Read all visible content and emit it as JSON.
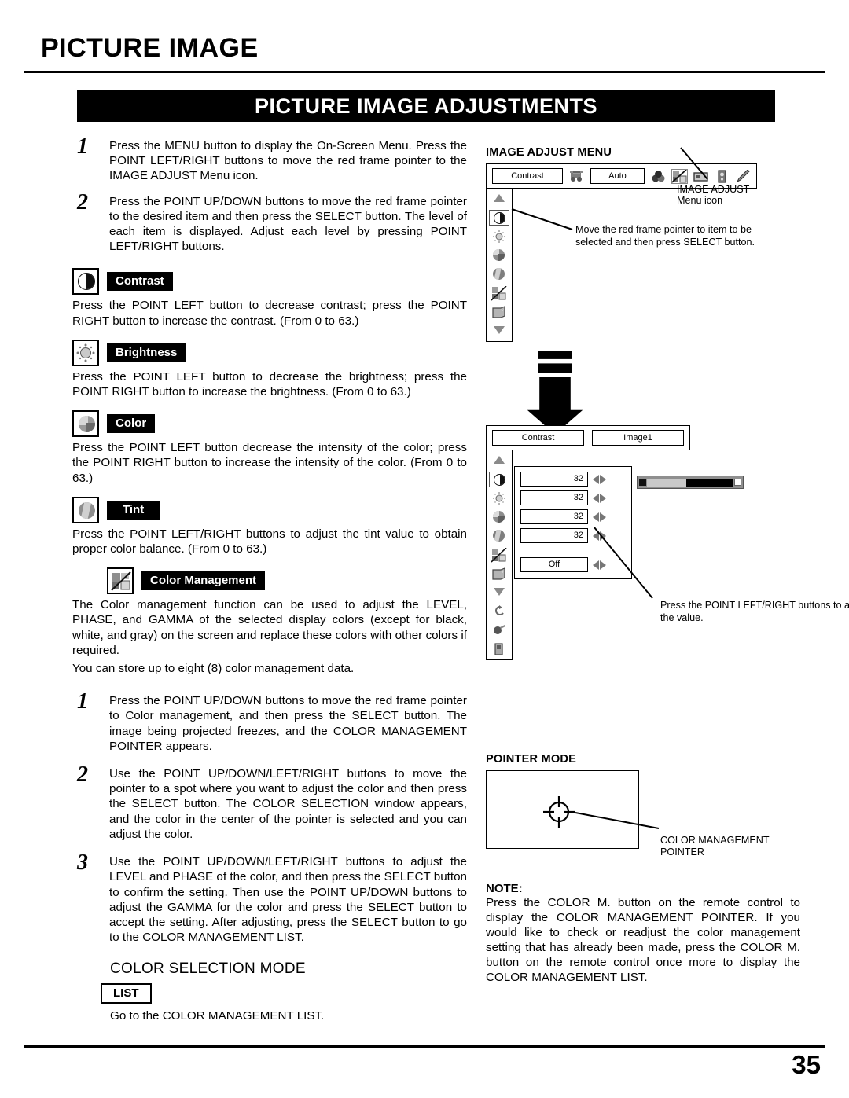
{
  "header": {
    "page_title": "PICTURE IMAGE",
    "banner": "PICTURE IMAGE ADJUSTMENTS",
    "page_number": "35"
  },
  "left": {
    "intro_steps": [
      {
        "num": "1",
        "text": "Press the MENU button to display the On-Screen Menu. Press the POINT LEFT/RIGHT buttons to move the red frame pointer to the IMAGE ADJUST Menu icon."
      },
      {
        "num": "2",
        "text": "Press the POINT UP/DOWN buttons to move the red frame pointer to the desired item and then press the SELECT button. The level of each item is displayed. Adjust each level by pressing POINT LEFT/RIGHT buttons."
      }
    ],
    "features": [
      {
        "icon": "contrast-icon",
        "label": "Contrast",
        "text": "Press the POINT LEFT button to decrease contrast; press the POINT RIGHT button to increase the contrast. (From 0 to 63.)"
      },
      {
        "icon": "brightness-icon",
        "label": "Brightness",
        "text": "Press the POINT LEFT button to decrease the brightness; press the POINT RIGHT button to increase the brightness. (From 0 to 63.)"
      },
      {
        "icon": "color-icon",
        "label": "Color",
        "text": "Press the POINT LEFT button decrease the intensity of the color; press the POINT RIGHT button to increase the intensity of the color.  (From 0 to 63.)"
      },
      {
        "icon": "tint-icon",
        "label": "Tint",
        "text": "Press the POINT LEFT/RIGHT buttons to adjust the tint value to obtain proper color balance. (From 0 to 63.)"
      },
      {
        "icon": "color-management-icon",
        "label": "Color Management",
        "text": "The Color management function can be used to adjust the LEVEL, PHASE, and GAMMA of the selected display colors (except for black, white, and gray) on the screen and replace these colors with other colors if required.",
        "text2": "You can store up to eight (8) color management data."
      }
    ],
    "cm_steps": [
      {
        "num": "1",
        "text": "Press the POINT UP/DOWN buttons to move the red frame pointer to Color management, and then press the SELECT button. The image being projected freezes, and the COLOR MANAGEMENT POINTER appears."
      },
      {
        "num": "2",
        "text": "Use the POINT UP/DOWN/LEFT/RIGHT buttons to move the pointer to a spot where you want to adjust the color and then press the SELECT button. The COLOR SELECTION window appears, and the color in the center of the pointer is selected and you can adjust the color."
      },
      {
        "num": "3",
        "text": "Use the POINT UP/DOWN/LEFT/RIGHT buttons to adjust the LEVEL and PHASE of the color, and then press the SELECT button to confirm the setting. Then use the POINT UP/DOWN buttons to adjust the GAMMA for the color and press the SELECT button to accept the setting. After adjusting, press the SELECT button to go to the COLOR MANAGEMENT LIST."
      }
    ],
    "color_selection_mode": {
      "title": "COLOR SELECTION MODE",
      "chip": "LIST",
      "desc": "Go to the COLOR MANAGEMENT LIST."
    }
  },
  "right": {
    "image_adjust_menu": {
      "heading": "IMAGE ADJUST MENU",
      "top_bar": {
        "field1": "Contrast",
        "field2": "Auto",
        "icons": [
          "gear-cart-icon",
          "color-balls-icon",
          "image-adjust-icon",
          "screen-icon",
          "sound-icon",
          "pointer-wand-icon"
        ]
      },
      "callout_menu_icon": "IMAGE ADJUST Menu icon",
      "callout_move_pointer": "Move the red frame pointer to item to be selected and then press SELECT button.",
      "rail_icons": [
        "up-arrow-icon",
        "contrast-icon",
        "brightness-icon",
        "color-icon",
        "tint-icon",
        "color-management-icon",
        "image-icon",
        "down-arrow-icon"
      ]
    },
    "value_menu": {
      "field1": "Contrast",
      "field2": "Image1",
      "values": [
        "32",
        "32",
        "32",
        "32"
      ],
      "off_value": "Off",
      "callout_adjust": "Press the POINT LEFT/RIGHT buttons to adjust the value.",
      "rail_icons": [
        "up-arrow-icon",
        "contrast-icon",
        "brightness-icon",
        "color-icon",
        "tint-icon",
        "color-management-icon",
        "image-icon",
        "down-arrow-icon",
        "reset-icon",
        "store-icon",
        "quit-icon"
      ]
    },
    "pointer_mode": {
      "heading": "POINTER MODE",
      "callout_line1": "COLOR MANAGEMENT",
      "callout_line2": "POINTER"
    },
    "note": {
      "title": "NOTE:",
      "text": "Press the COLOR M. button on the remote control to display the COLOR MANAGEMENT POINTER. If you would like to check or readjust the color management setting that has already been made, press the COLOR M. button on the remote control once more to display the COLOR MANAGEMENT LIST."
    }
  }
}
